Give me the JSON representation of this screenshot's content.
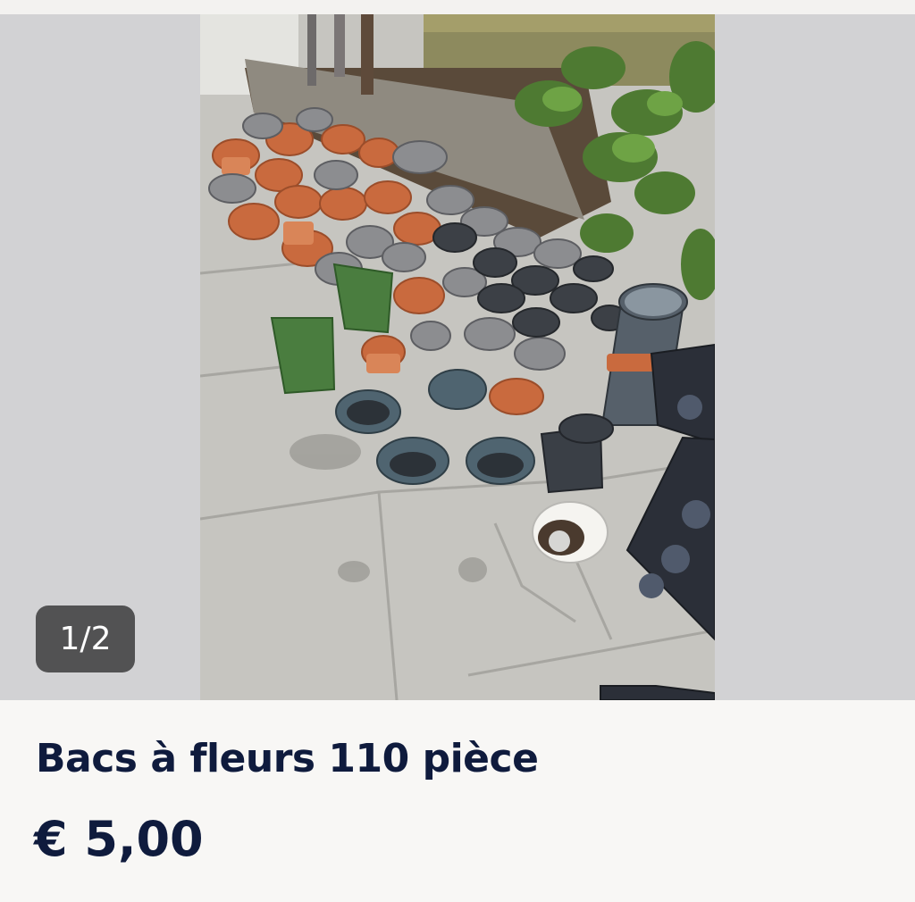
{
  "gallery": {
    "counter": "1/2",
    "photo_subject": "listing-photo"
  },
  "listing": {
    "title": "Bacs à fleurs 110 pièce",
    "price": "€ 5,00"
  },
  "colors": {
    "text": "#0f1b3d",
    "gallery_bg": "#d2d2d4",
    "counter_bg": "#3c3c3c"
  }
}
